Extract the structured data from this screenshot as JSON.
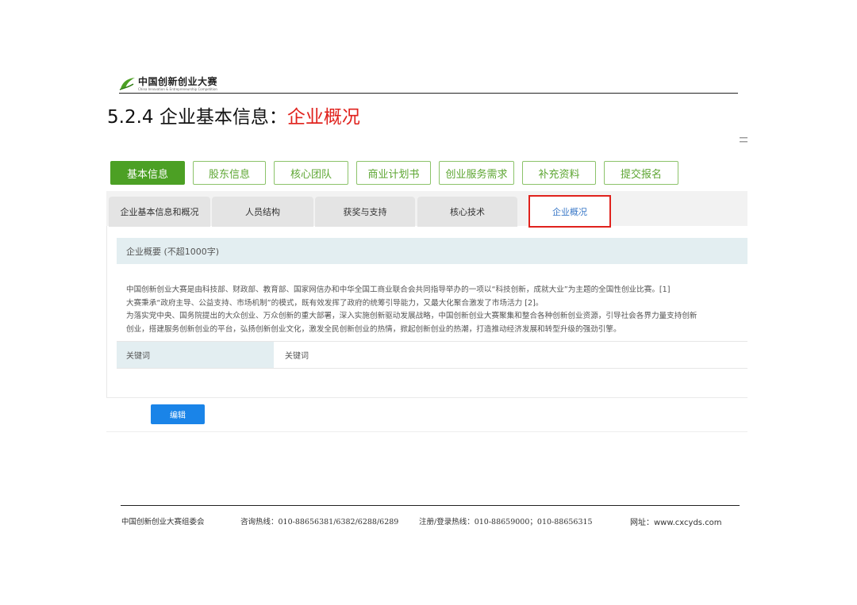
{
  "header": {
    "logo_name": "中国创新创业大赛",
    "logo_sub": "China Innovation & Entrepreneurship Competition",
    "heading_prefix": "5.2.4 企业基本信息：",
    "heading_highlight": "企业概况"
  },
  "menu_icon": "hamburger-icon",
  "main_tabs": [
    {
      "label": "基本信息",
      "active": true
    },
    {
      "label": "股东信息"
    },
    {
      "label": "核心团队"
    },
    {
      "label": "商业计划书"
    },
    {
      "label": "创业服务需求"
    },
    {
      "label": "补充资料"
    },
    {
      "label": "提交报名"
    }
  ],
  "sub_tabs": [
    {
      "label": "企业基本信息和概况"
    },
    {
      "label": "人员结构"
    },
    {
      "label": "获奖与支持"
    },
    {
      "label": "核心技术"
    },
    {
      "label": "企业概况",
      "active": true
    }
  ],
  "content": {
    "section_title": "企业概要 (不超1000字)",
    "description_lines": [
      "中国创新创业大赛是由科技部、财政部、教育部、国家网信办和中华全国工商业联合会共同指导举办的一项以“科技创新，成就大业”为主题的全国性创业比赛。[1]",
      "大赛秉承“政府主导、公益支持、市场机制”的模式，既有效发挥了政府的统筹引导能力，又最大化聚合激发了市场活力 [2]。",
      "为落实党中央、国务院提出的大众创业、万众创新的重大部署，深入实施创新驱动发展战略，中国创新创业大赛聚集和整合各种创新创业资源，引导社会各界力量支持创新",
      "创业，搭建服务创新创业的平台，弘扬创新创业文化，激发全民创新创业的热情，掀起创新创业的热潮，打造推动经济发展和转型升级的强劲引擎。"
    ],
    "keyword_label": "关键词",
    "keyword_value": "关键词",
    "edit_button": "编辑"
  },
  "footer": {
    "org": "中国创新创业大赛组委会",
    "hotline": "咨询热线：010-88656381/6382/6288/6289",
    "register": "注册/登录热线：010-88659000；010-88656315",
    "website": "网址：www.cxcyds.com"
  },
  "colors": {
    "accent_green": "#4ca024",
    "highlight_red": "#e0221d",
    "button_blue": "#1a84e8"
  }
}
